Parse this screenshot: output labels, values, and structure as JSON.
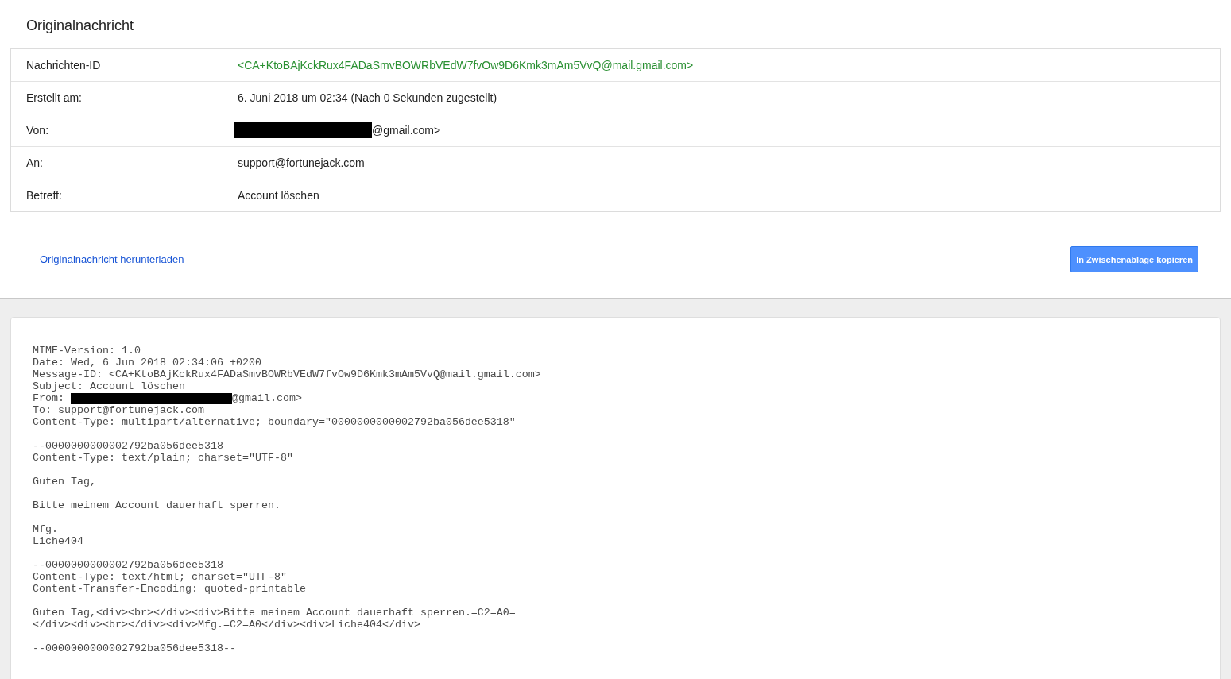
{
  "title": "Originalnachricht",
  "details": {
    "rows": [
      {
        "kind": "id",
        "label": "Nachrichten-ID",
        "value": "<CA+KtoBAjKckRux4FADaSmvBOWRbVEdW7fvOw9D6Kmk3mAm5VvQ@mail.gmail.com>"
      },
      {
        "kind": "text",
        "label": "Erstellt am:",
        "value": "6. Juni 2018 um 02:34 (Nach 0 Sekunden zugestellt)"
      },
      {
        "kind": "redacted",
        "label": "Von:",
        "value": "@gmail.com>"
      },
      {
        "kind": "text",
        "label": "An:",
        "value": "support@fortunejack.com"
      },
      {
        "kind": "text",
        "label": "Betreff:",
        "value": "Account löschen"
      }
    ]
  },
  "actions": {
    "download_link": "Originalnachricht herunterladen",
    "copy_button": "In Zwischenablage kopieren"
  },
  "raw_message": {
    "blocks": [
      [
        {
          "kind": "text",
          "text": "MIME-Version: 1.0"
        },
        {
          "kind": "text",
          "text": "Date: Wed, 6 Jun 2018 02:34:06 +0200"
        },
        {
          "kind": "text",
          "text": "Message-ID: <CA+KtoBAjKckRux4FADaSmvBOWRbVEdW7fvOw9D6Kmk3mAm5VvQ@mail.gmail.com>"
        },
        {
          "kind": "text",
          "text": "Subject: Account löschen"
        },
        {
          "kind": "redacted",
          "before": "From:",
          "after": "@gmail.com>"
        },
        {
          "kind": "text",
          "text": "To: support@fortunejack.com"
        },
        {
          "kind": "text",
          "text": "Content-Type: multipart/alternative; boundary=\"0000000000002792ba056dee5318\""
        }
      ],
      [
        {
          "kind": "text",
          "text": "--0000000000002792ba056dee5318"
        },
        {
          "kind": "text",
          "text": "Content-Type: text/plain; charset=\"UTF-8\""
        }
      ],
      [
        {
          "kind": "text",
          "text": "Guten Tag,"
        }
      ],
      [
        {
          "kind": "text",
          "text": "Bitte meinem Account dauerhaft sperren."
        }
      ],
      [
        {
          "kind": "text",
          "text": "Mfg."
        },
        {
          "kind": "text",
          "text": "Liche404"
        }
      ],
      [
        {
          "kind": "text",
          "text": "--0000000000002792ba056dee5318"
        },
        {
          "kind": "text",
          "text": "Content-Type: text/html; charset=\"UTF-8\""
        },
        {
          "kind": "text",
          "text": "Content-Transfer-Encoding: quoted-printable"
        }
      ],
      [
        {
          "kind": "text",
          "text": "Guten Tag,<div><br></div><div>Bitte meinem Account dauerhaft sperren.=C2=A0="
        },
        {
          "kind": "text",
          "text": "</div><div><br></div><div>Mfg.=C2=A0</div><div>Liche404</div>"
        }
      ],
      [
        {
          "kind": "text",
          "text": "--0000000000002792ba056dee5318--"
        }
      ]
    ]
  }
}
